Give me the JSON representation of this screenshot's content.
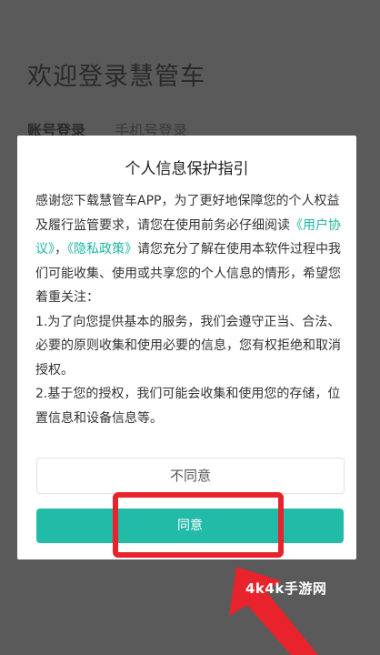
{
  "background": {
    "title": "欢迎登录慧管车",
    "tabs": [
      "账号登录",
      "手机号登录"
    ]
  },
  "dialog": {
    "title": "个人信息保护指引",
    "intro_part1": "感谢您下载慧管车APP，为了更好地保障您的个人权益及履行监管要求，请您在使用前务必仔细阅读",
    "link_user_agreement": "《用户协议》",
    "separator": "，",
    "link_privacy_policy": "《隐私政策》",
    "intro_part2": "请您充分了解在使用本软件过程中我们可能收集、使用或共享您的个人信息的情形，希望您着重关注：",
    "point1": "1.为了向您提供基本的服务，我们会遵守正当、合法、必要的原则收集和使用必要的信息，您有权拒绝和取消授权。",
    "point2": "2.基于您的授权，我们可能会收集和使用您的存储，位置信息和设备信息等。",
    "disagree_label": "不同意",
    "agree_label": "同意"
  },
  "watermark": "4k4k手游网",
  "colors": {
    "accent": "#22bba7",
    "link": "#1fb5a2",
    "highlight": "#e8232b",
    "overlay": "#5a5a5a"
  }
}
